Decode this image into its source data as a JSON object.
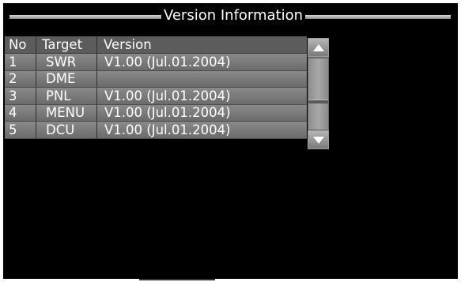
{
  "window": {
    "title": "Version Information"
  },
  "table": {
    "headers": {
      "no": "No",
      "target": "Target",
      "version": "Version"
    },
    "rows": [
      {
        "no": "1",
        "target": "SWR",
        "version": "V1.00 (Jul.01.2004)"
      },
      {
        "no": "2",
        "target": "DME",
        "version": ""
      },
      {
        "no": "3",
        "target": "PNL",
        "version": "V1.00 (Jul.01.2004)"
      },
      {
        "no": "4",
        "target": "MENU",
        "version": "V1.00 (Jul.01.2004)"
      },
      {
        "no": "5",
        "target": "DCU",
        "version": "V1.00 (Jul.01.2004)"
      }
    ]
  },
  "scrollbar": {
    "up_icon": "triangle-up-icon",
    "down_icon": "triangle-down-icon"
  },
  "colors": {
    "background": "#000000",
    "row_fill": "#7a7a7a",
    "header_fill": "#5c5c5c",
    "text": "#ffffff"
  }
}
